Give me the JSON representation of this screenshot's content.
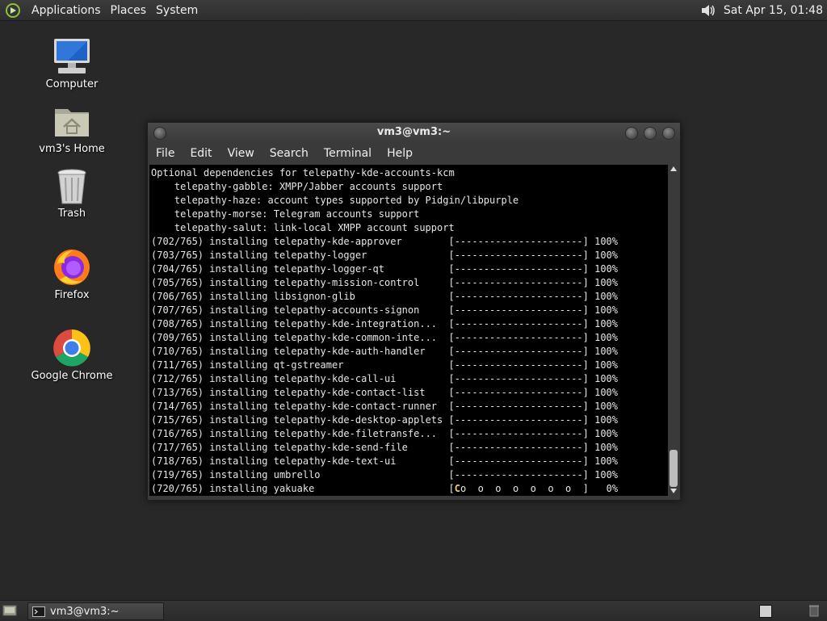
{
  "top_panel": {
    "menus": [
      "Applications",
      "Places",
      "System"
    ],
    "clock": "Sat Apr 15, 01:48"
  },
  "desktop_icons": [
    {
      "label": "Computer",
      "icon": "computer-icon"
    },
    {
      "label": "vm3's Home",
      "icon": "home-folder-icon"
    },
    {
      "label": "Trash",
      "icon": "trash-icon"
    },
    {
      "label": "Firefox",
      "icon": "firefox-icon"
    },
    {
      "label": "Google Chrome",
      "icon": "chrome-icon"
    }
  ],
  "terminal": {
    "title": "vm3@vm3:~",
    "menu": [
      "File",
      "Edit",
      "View",
      "Search",
      "Terminal",
      "Help"
    ],
    "header_lines": [
      "Optional dependencies for telepathy-kde-accounts-kcm",
      "    telepathy-gabble: XMPP/Jabber accounts support",
      "    telepathy-haze: account types supported by Pidgin/libpurple",
      "    telepathy-morse: Telegram accounts support",
      "    telepathy-salut: link-local XMPP account support"
    ],
    "progress_lines": [
      {
        "count": "(702/765)",
        "text": "installing telepathy-kde-approver",
        "bar": "[----------------------]",
        "pct": "100%"
      },
      {
        "count": "(703/765)",
        "text": "installing telepathy-logger",
        "bar": "[----------------------]",
        "pct": "100%"
      },
      {
        "count": "(704/765)",
        "text": "installing telepathy-logger-qt",
        "bar": "[----------------------]",
        "pct": "100%"
      },
      {
        "count": "(705/765)",
        "text": "installing telepathy-mission-control",
        "bar": "[----------------------]",
        "pct": "100%"
      },
      {
        "count": "(706/765)",
        "text": "installing libsignon-glib",
        "bar": "[----------------------]",
        "pct": "100%"
      },
      {
        "count": "(707/765)",
        "text": "installing telepathy-accounts-signon",
        "bar": "[----------------------]",
        "pct": "100%"
      },
      {
        "count": "(708/765)",
        "text": "installing telepathy-kde-integration...",
        "bar": "[----------------------]",
        "pct": "100%"
      },
      {
        "count": "(709/765)",
        "text": "installing telepathy-kde-common-inte...",
        "bar": "[----------------------]",
        "pct": "100%"
      },
      {
        "count": "(710/765)",
        "text": "installing telepathy-kde-auth-handler",
        "bar": "[----------------------]",
        "pct": "100%"
      },
      {
        "count": "(711/765)",
        "text": "installing qt-gstreamer",
        "bar": "[----------------------]",
        "pct": "100%"
      },
      {
        "count": "(712/765)",
        "text": "installing telepathy-kde-call-ui",
        "bar": "[----------------------]",
        "pct": "100%"
      },
      {
        "count": "(713/765)",
        "text": "installing telepathy-kde-contact-list",
        "bar": "[----------------------]",
        "pct": "100%"
      },
      {
        "count": "(714/765)",
        "text": "installing telepathy-kde-contact-runner",
        "bar": "[----------------------]",
        "pct": "100%"
      },
      {
        "count": "(715/765)",
        "text": "installing telepathy-kde-desktop-applets",
        "bar": "[----------------------]",
        "pct": "100%"
      },
      {
        "count": "(716/765)",
        "text": "installing telepathy-kde-filetransfe...",
        "bar": "[----------------------]",
        "pct": "100%"
      },
      {
        "count": "(717/765)",
        "text": "installing telepathy-kde-send-file",
        "bar": "[----------------------]",
        "pct": "100%"
      },
      {
        "count": "(718/765)",
        "text": "installing telepathy-kde-text-ui",
        "bar": "[----------------------]",
        "pct": "100%"
      },
      {
        "count": "(719/765)",
        "text": "installing umbrello",
        "bar": "[----------------------]",
        "pct": "100%"
      },
      {
        "count": "(720/765)",
        "text": "installing yakuake",
        "bar_cursor": "C",
        "bar": "[Co  o  o  o  o  o  o  ]",
        "pct": "0%"
      }
    ]
  },
  "taskbar": {
    "window_button": "vm3@vm3:~"
  },
  "colors": {
    "desktop_bg": "#282828",
    "panel_bg": "#333333",
    "terminal_bg": "#000000",
    "terminal_fg": "#e6e6e6",
    "pacman_cursor": "#f1d36b"
  }
}
